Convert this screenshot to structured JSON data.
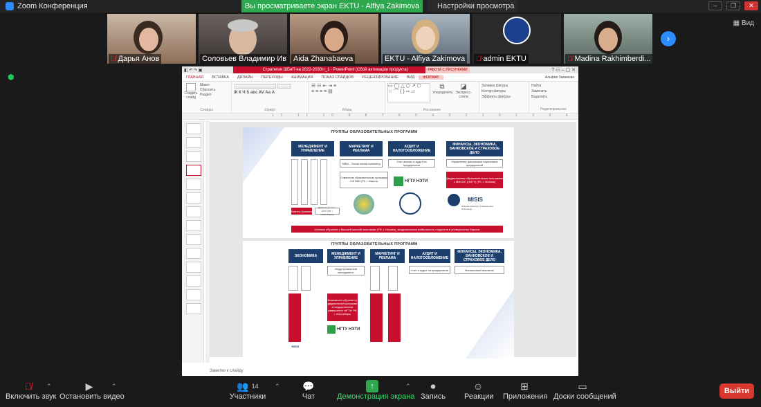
{
  "window": {
    "app_title": "Zoom Конференция",
    "share_banner": "Вы просматриваете экран EKTU - Alfiya Zakimova",
    "view_options": "Настройки просмотра"
  },
  "view_toggle": "Вид",
  "participants": [
    {
      "name": "Дарья Анов",
      "muted": true
    },
    {
      "name": "Соловьев Владимир Ив...",
      "muted": false
    },
    {
      "name": "Aida Zhanabaeva",
      "muted": false
    },
    {
      "name": "EKTU - Alfiya Zakimova",
      "muted": false
    },
    {
      "name": "admin EKTU",
      "muted": true
    },
    {
      "name": "Madina Rakhimberdi...",
      "muted": true
    }
  ],
  "ppt": {
    "title": "Стратегия ШБиП на 2022-2030гг_1 - PowerPoint (Сбой активации продукта)",
    "context_tab": "РАБОТА С РИСУНКАМИ",
    "tabs": [
      "ГЛАВНАЯ",
      "ВСТАВКА",
      "ДИЗАЙН",
      "ПЕРЕХОДЫ",
      "АНИМАЦИЯ",
      "ПОКАЗ СЛАЙДОВ",
      "РЕЦЕНЗИРОВАНИЕ",
      "ВИД",
      "ФОРМАТ"
    ],
    "user": "Альфия Закимова",
    "groups": {
      "slides": "Слайды",
      "font": "Шрифт",
      "paragraph": "Абзац",
      "drawing": "Рисование",
      "editing": "Редактирование"
    },
    "ribbon": {
      "new_slide": "Создать слайд",
      "layout": "Макет",
      "reset": "Сбросить",
      "section": "Раздел",
      "arrange": "Упорядочить",
      "quick_styles": "Экспресс-стили",
      "fill": "Заливка фигуры",
      "outline": "Контур фигуры",
      "effects": "Эффекты фигуры",
      "find": "Найти",
      "replace": "Заменить",
      "select": "Выделить"
    },
    "notes_placeholder": "Заметки к слайду",
    "slide1": {
      "header": "ГРУППЫ ОБРАЗОВАТЕЛЬНЫХ ПРОГРАММ",
      "groups": [
        "МЕНЕДЖМЕНТ И УПРАВЛЕНИЕ",
        "МАРКЕТИНГ И РЕКЛАМА",
        "АУДИТ И НАЛОГООБЛОЖЕНИЕ",
        "ФИНАНСЫ, ЭКОНОМИКА, БАНКОВСКОЕ И СТРАХОВОЕ ДЕЛО"
      ],
      "subs": [
        "SMM – Social media marketing",
        "Учет анализ и аудит на предприятии",
        "Управление финансами наукоемких предприятий"
      ],
      "joint1": "Совместная образовательная программа с МГИМО (РК, г. Алматы)",
      "joint2": "Двудипломная образовательная программа с МИСИС (НИТУ) (РК, г. Москва)",
      "grants": "Гранты Акимата",
      "double": "Двойной диплом с НГТУ (РФ, г. Новосибирск)",
      "logo_ngtu": "НГТУ НЭТИ",
      "logo_misis": "MISIS",
      "misis_sub": "National University of Science and Technology",
      "bottom": "Сетевое обучение с Высшей школой экономики (РФ, г. Москва), академическая мобильность студентов в университеты Европы"
    },
    "slide2": {
      "header": "ГРУППЫ ОБРАЗОВАТЕЛЬНЫХ ПРОГРАММ",
      "groups": [
        "ЭКОНОМИКА",
        "МЕНЕДЖМЕНТ И УПРАВЛЕНИЕ",
        "МАРКЕТИНГ И РЕКЛАМА",
        "АУДИТ И НАЛОГООБЛОЖЕНИЕ",
        "ФИНАНСЫ, ЭКОНОМИКА, БАНКОВСКОЕ И СТРАХОВОЕ ДЕЛО"
      ],
      "subs": [
        "Индустриальный менеджмент",
        "Учет и аудит на предприятии",
        "Финансовый аналитик"
      ],
      "opportunity": "Возможность обучения по двудипломной программе в государственном университете «НГТУ» РФ, г. Новосибирск",
      "logo_ngtu": "НГТУ НЭТИ",
      "logo_misis": "MISIS"
    }
  },
  "toolbar": {
    "mute": "Включить звук",
    "video": "Остановить видео",
    "participants": "Участники",
    "participants_count": "14",
    "chat": "Чат",
    "share": "Демонстрация экрана",
    "record": "Запись",
    "reactions": "Реакции",
    "apps": "Приложения",
    "whiteboards": "Доски сообщений",
    "leave": "Выйти"
  },
  "colors": {
    "accent": "#2d8cff",
    "share_green": "#2da84f",
    "ppt_red": "#c8102e",
    "navy": "#1c3f6e",
    "leave_red": "#d9382e"
  }
}
